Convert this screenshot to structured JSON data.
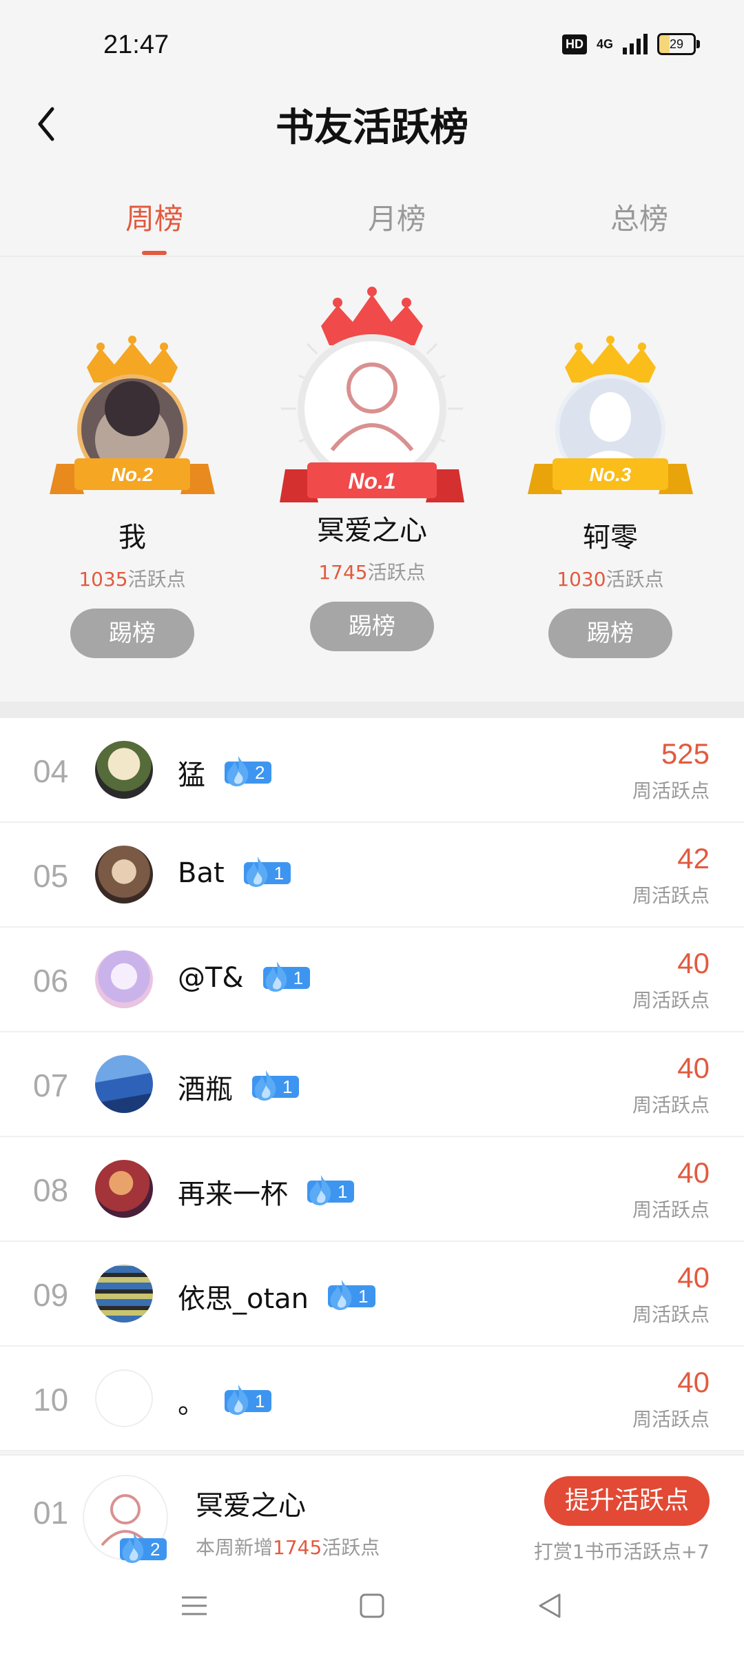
{
  "status_bar": {
    "time": "21:47",
    "hd": "HD",
    "network": "4G",
    "battery": "29"
  },
  "header": {
    "title": "书友活跃榜"
  },
  "tabs": [
    {
      "label": "周榜",
      "active": true
    },
    {
      "label": "月榜",
      "active": false
    },
    {
      "label": "总榜",
      "active": false
    }
  ],
  "podium": {
    "second": {
      "rank_label": "No.2",
      "name": "我",
      "points": "1035",
      "points_suffix": "活跃点",
      "button": "踢榜"
    },
    "first": {
      "rank_label": "No.1",
      "name": "冥爱之心",
      "points": "1745",
      "points_suffix": "活跃点",
      "button": "踢榜"
    },
    "third": {
      "rank_label": "No.3",
      "name": "轲零",
      "points": "1030",
      "points_suffix": "活跃点",
      "button": "踢榜"
    }
  },
  "list": [
    {
      "rank": "04",
      "name": "猛",
      "level": "2",
      "score": "525",
      "score_label": "周活跃点"
    },
    {
      "rank": "05",
      "name": "Bat",
      "level": "1",
      "score": "42",
      "score_label": "周活跃点"
    },
    {
      "rank": "06",
      "name": "@T&",
      "level": "1",
      "score": "40",
      "score_label": "周活跃点"
    },
    {
      "rank": "07",
      "name": "酒瓶",
      "level": "1",
      "score": "40",
      "score_label": "周活跃点"
    },
    {
      "rank": "08",
      "name": "再来一杯",
      "level": "1",
      "score": "40",
      "score_label": "周活跃点"
    },
    {
      "rank": "09",
      "name": "依思_otan",
      "level": "1",
      "score": "40",
      "score_label": "周活跃点"
    },
    {
      "rank": "10",
      "name": "。",
      "level": "1",
      "score": "40",
      "score_label": "周活跃点"
    }
  ],
  "my_rank": {
    "rank": "01",
    "name": "冥爱之心",
    "level": "2",
    "sub_prefix": "本周新增",
    "sub_points": "1745",
    "sub_suffix": "活跃点",
    "button": "提升活跃点",
    "reward_hint": "打赏1书币活跃点+7"
  },
  "colors": {
    "accent": "#e25a3f",
    "badge": "#3d95f0",
    "gold": "#f5a623",
    "red_crown": "#f04a4a",
    "yellow_crown": "#fbbd19"
  }
}
